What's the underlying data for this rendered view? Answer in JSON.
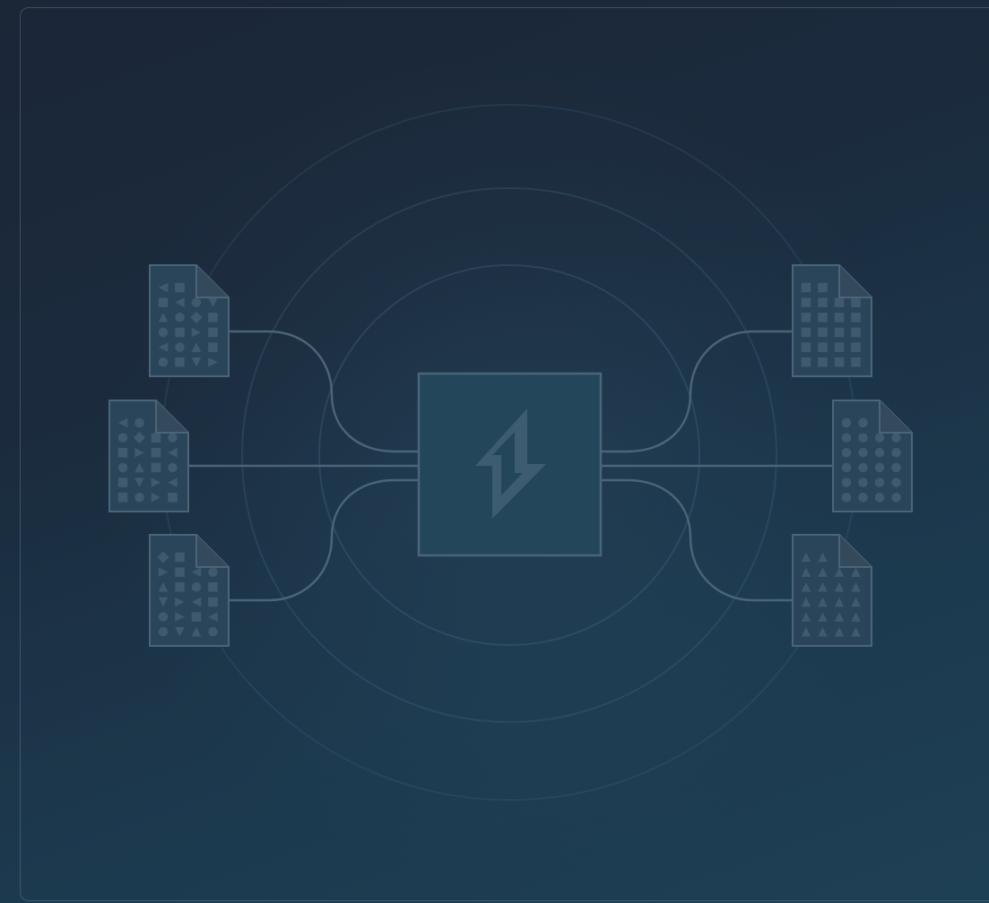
{
  "diagram": {
    "title": "",
    "hub": {
      "icon": "bolt-icon"
    },
    "inputs": [
      {
        "id": "input-doc-1",
        "icon": "mixed-shapes-document-icon"
      },
      {
        "id": "input-doc-2",
        "icon": "mixed-shapes-document-icon"
      },
      {
        "id": "input-doc-3",
        "icon": "mixed-shapes-document-icon"
      }
    ],
    "outputs": [
      {
        "id": "output-doc-1",
        "icon": "squares-document-icon"
      },
      {
        "id": "output-doc-2",
        "icon": "circles-document-icon"
      },
      {
        "id": "output-doc-3",
        "icon": "triangles-document-icon"
      }
    ],
    "colors": {
      "background": "#1b2636",
      "stroke": "#4a6478",
      "document_fill": "#2a4459",
      "hub_fill": "#25465a",
      "glyph": "#41596d"
    }
  }
}
